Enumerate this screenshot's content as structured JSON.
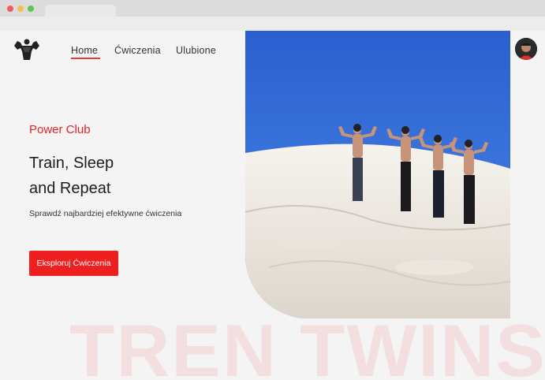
{
  "nav": {
    "items": [
      {
        "label": "Home"
      },
      {
        "label": "Ćwiczenia"
      },
      {
        "label": "Ulubione"
      }
    ]
  },
  "hero": {
    "kicker": "Power Club",
    "title_line1": "Train, Sleep",
    "title_line2": "and Repeat",
    "subtitle": "Sprawdź najbardziej efektywne ćwiczenia",
    "cta_label": "Eksploruj Ćwiczenia",
    "watermark": "TREN TWINS"
  },
  "icons": {
    "logo": "muscle-man-icon",
    "avatar": "user-avatar"
  },
  "colors": {
    "accent": "#ee1f1f",
    "page_bg": "#f5f4f5",
    "text": "#1e1e1e"
  }
}
